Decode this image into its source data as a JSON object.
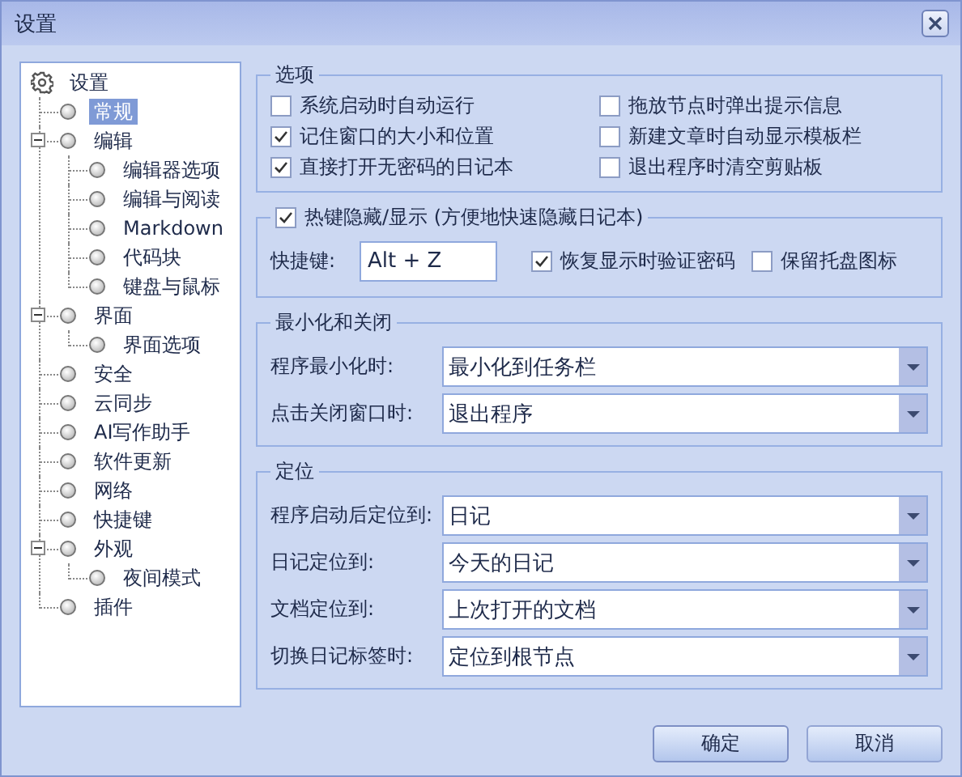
{
  "window": {
    "title": "设置"
  },
  "tree": {
    "label": "设置",
    "selected": false,
    "children": [
      {
        "label": "常规",
        "selected": true
      },
      {
        "label": "编辑",
        "selected": false,
        "expanded": true,
        "children": [
          {
            "label": "编辑器选项",
            "selected": false
          },
          {
            "label": "编辑与阅读",
            "selected": false
          },
          {
            "label": "Markdown",
            "selected": false
          },
          {
            "label": "代码块",
            "selected": false
          },
          {
            "label": "键盘与鼠标",
            "selected": false
          }
        ]
      },
      {
        "label": "界面",
        "selected": false,
        "expanded": true,
        "children": [
          {
            "label": "界面选项",
            "selected": false
          }
        ]
      },
      {
        "label": "安全",
        "selected": false
      },
      {
        "label": "云同步",
        "selected": false
      },
      {
        "label": "AI写作助手",
        "selected": false
      },
      {
        "label": "软件更新",
        "selected": false
      },
      {
        "label": "网络",
        "selected": false
      },
      {
        "label": "快捷键",
        "selected": false
      },
      {
        "label": "外观",
        "selected": false,
        "expanded": true,
        "children": [
          {
            "label": "夜间模式",
            "selected": false
          }
        ]
      },
      {
        "label": "插件",
        "selected": false
      }
    ]
  },
  "options": {
    "title": "选项",
    "checkboxes": [
      {
        "label": "系统启动时自动运行",
        "checked": false
      },
      {
        "label": "拖放节点时弹出提示信息",
        "checked": false
      },
      {
        "label": "记住窗口的大小和位置",
        "checked": true
      },
      {
        "label": "新建文章时自动显示模板栏",
        "checked": false
      },
      {
        "label": "直接打开无密码的日记本",
        "checked": true
      },
      {
        "label": "退出程序时清空剪贴板",
        "checked": false
      }
    ]
  },
  "hotkey": {
    "label": "热键隐藏/显示 (方便地快速隐藏日记本)",
    "checked": true,
    "field_label": "快捷键:",
    "value": "Alt + Z",
    "checkboxes": [
      {
        "label": "恢复显示时验证密码",
        "checked": true
      },
      {
        "label": "保留托盘图标",
        "checked": false
      }
    ]
  },
  "sections": [
    {
      "title": "最小化和关闭",
      "rows": [
        {
          "label": "程序最小化时:",
          "value": "最小化到任务栏"
        },
        {
          "label": "点击关闭窗口时:",
          "value": "退出程序"
        }
      ]
    },
    {
      "title": "定位",
      "rows": [
        {
          "label": "程序启动后定位到:",
          "value": "日记"
        },
        {
          "label": "日记定位到:",
          "value": "今天的日记"
        },
        {
          "label": "文档定位到:",
          "value": "上次打开的文档"
        },
        {
          "label": "切换日记标签时:",
          "value": "定位到根节点"
        }
      ]
    }
  ],
  "buttons": [
    "确定",
    "取消"
  ]
}
